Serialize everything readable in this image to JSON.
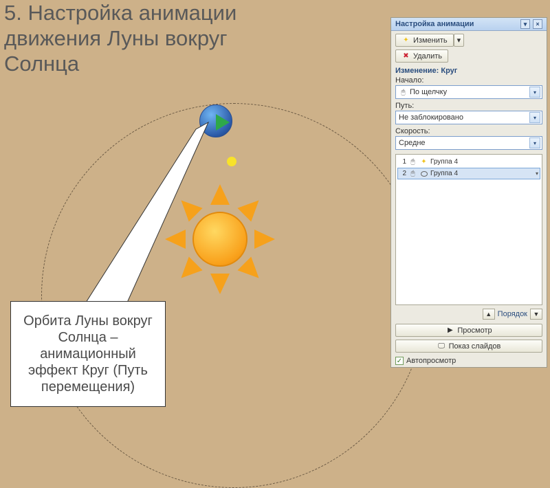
{
  "title": "5. Настройка анимации движения Луны вокруг Солнца",
  "callout": "Орбита Луны вокруг Солнца – анимационный эффект Круг (Путь перемещения)",
  "panel": {
    "header": "Настройка анимации",
    "change_btn": "Изменить",
    "remove_btn": "Удалить",
    "section_title": "Изменение: Круг",
    "start_label": "Начало:",
    "start_value": "По щелчку",
    "path_label": "Путь:",
    "path_value": "Не заблокировано",
    "speed_label": "Скорость:",
    "speed_value": "Средне",
    "items": [
      {
        "num": "1",
        "label": "Группа 4"
      },
      {
        "num": "2",
        "label": "Группа 4"
      }
    ],
    "reorder_label": "Порядок",
    "preview_btn": "Просмотр",
    "slideshow_btn": "Показ слайдов",
    "autoplay": "Автопросмотр"
  }
}
